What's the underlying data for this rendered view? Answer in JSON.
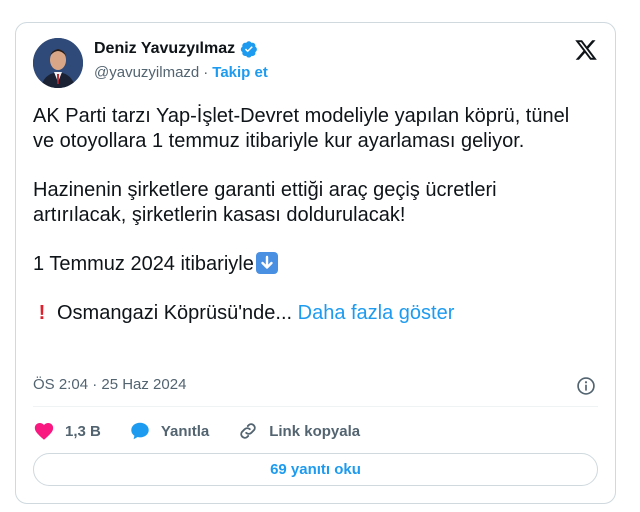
{
  "author": {
    "name": "Deniz Yavuzyılmaz",
    "handle": "@yavuzyilmazd",
    "separator": "·",
    "follow_label": "Takip et"
  },
  "tweet": {
    "line1": "AK Parti tarzı Yap-İşlet-Devret modeliyle yapılan köprü, tünel ve otoyollara 1 temmuz itibariyle kur ayarlaması geliyor.",
    "line2": "Hazinenin şirketlere garanti ettiği araç geçiş ücretleri artırılacak, şirketlerin kasası doldurulacak!",
    "line3": "1 Temmuz 2024 itibariyle",
    "line4_text": "Osmangazi Köprüsü'nde...",
    "line4_bang": "!",
    "show_more": "Daha fazla göster"
  },
  "meta": {
    "timestamp": "ÖS 2:04 · 25 Haz 2024"
  },
  "actions": {
    "likes": "1,3 B",
    "reply_label": "Yanıtla",
    "copy_link_label": "Link kopyala"
  },
  "replies_button": "69 yanıtı oku",
  "colors": {
    "accent": "#1d9bf0",
    "like": "#f91880",
    "muted": "#536471"
  },
  "icons": [
    "verified-badge-icon",
    "x-logo-icon",
    "down-arrow-emoji-icon",
    "info-icon",
    "heart-icon",
    "reply-bubble-icon",
    "link-icon"
  ]
}
